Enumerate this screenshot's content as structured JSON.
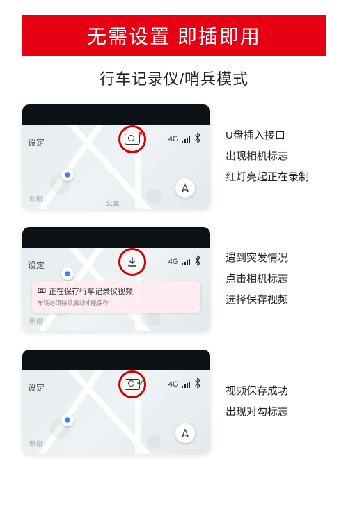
{
  "banner": "无需设置  即插即用",
  "subtitle": "行车记录仪/哨兵模式",
  "status": {
    "net": "4G"
  },
  "card_labels": {
    "settings": "设定",
    "map_a": "新柳",
    "map_b": "公寓"
  },
  "toast": {
    "line1": "正在保存行车记录仪视频",
    "line2": "车辆必须持续启动才能保存"
  },
  "steps": [
    {
      "lines": [
        "U盘插入接口",
        "出现相机标志",
        "红灯亮起正在录制"
      ]
    },
    {
      "lines": [
        "遇到突发情况",
        "点击相机标志",
        "选择保存视频"
      ]
    },
    {
      "lines": [
        "视频保存成功",
        "出现对勾标志"
      ]
    }
  ]
}
